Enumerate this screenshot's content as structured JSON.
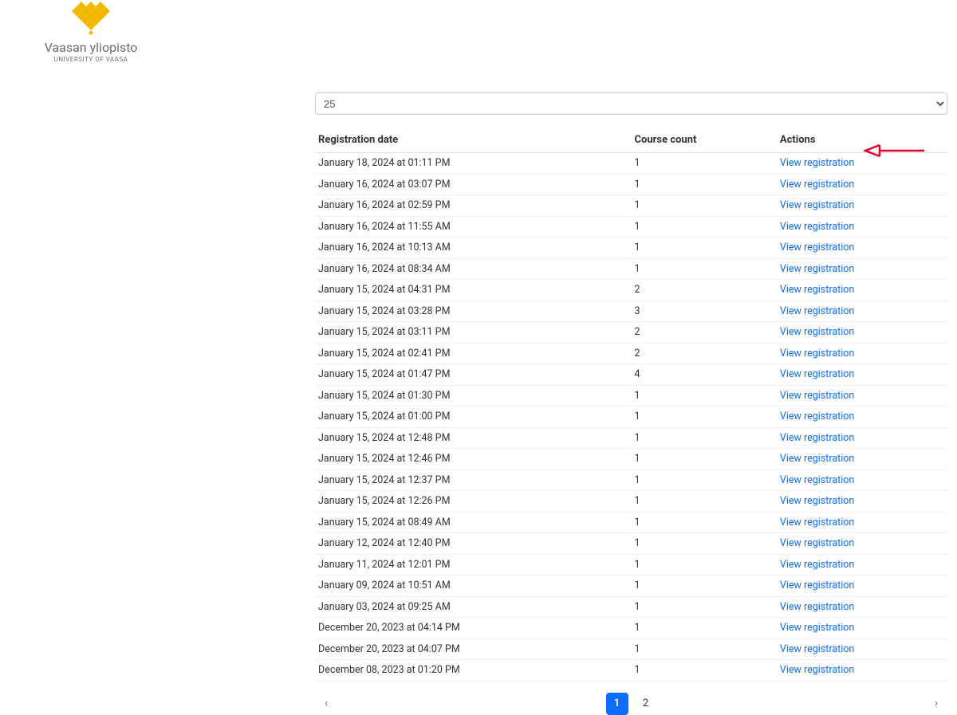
{
  "brand": {
    "name": "Vaasan yliopisto",
    "subtitle": "UNIVERSITY OF VAASA"
  },
  "page_size": {
    "selected": "25"
  },
  "table": {
    "headers": {
      "date": "Registration date",
      "count": "Course count",
      "actions": "Actions"
    },
    "action_label": "View registration",
    "rows": [
      {
        "date": "January 18, 2024 at 01:11 PM",
        "count": "1"
      },
      {
        "date": "January 16, 2024 at 03:07 PM",
        "count": "1"
      },
      {
        "date": "January 16, 2024 at 02:59 PM",
        "count": "1"
      },
      {
        "date": "January 16, 2024 at 11:55 AM",
        "count": "1"
      },
      {
        "date": "January 16, 2024 at 10:13 AM",
        "count": "1"
      },
      {
        "date": "January 16, 2024 at 08:34 AM",
        "count": "1"
      },
      {
        "date": "January 15, 2024 at 04:31 PM",
        "count": "2"
      },
      {
        "date": "January 15, 2024 at 03:28 PM",
        "count": "3"
      },
      {
        "date": "January 15, 2024 at 03:11 PM",
        "count": "2"
      },
      {
        "date": "January 15, 2024 at 02:41 PM",
        "count": "2"
      },
      {
        "date": "January 15, 2024 at 01:47 PM",
        "count": "4"
      },
      {
        "date": "January 15, 2024 at 01:30 PM",
        "count": "1"
      },
      {
        "date": "January 15, 2024 at 01:00 PM",
        "count": "1"
      },
      {
        "date": "January 15, 2024 at 12:48 PM",
        "count": "1"
      },
      {
        "date": "January 15, 2024 at 12:46 PM",
        "count": "1"
      },
      {
        "date": "January 15, 2024 at 12:37 PM",
        "count": "1"
      },
      {
        "date": "January 15, 2024 at 12:26 PM",
        "count": "1"
      },
      {
        "date": "January 15, 2024 at 08:49 AM",
        "count": "1"
      },
      {
        "date": "January 12, 2024 at 12:40 PM",
        "count": "1"
      },
      {
        "date": "January 11, 2024 at 12:01 PM",
        "count": "1"
      },
      {
        "date": "January 09, 2024 at 10:51 AM",
        "count": "1"
      },
      {
        "date": "January 03, 2024 at 09:25 AM",
        "count": "1"
      },
      {
        "date": "December 20, 2023 at 04:14 PM",
        "count": "1"
      },
      {
        "date": "December 20, 2023 at 04:07 PM",
        "count": "1"
      },
      {
        "date": "December 08, 2023 at 01:20 PM",
        "count": "1"
      }
    ]
  },
  "pagination": {
    "pages": [
      "1",
      "2"
    ],
    "active_index": 0
  },
  "annotation_arrow_color": "#e4002b"
}
